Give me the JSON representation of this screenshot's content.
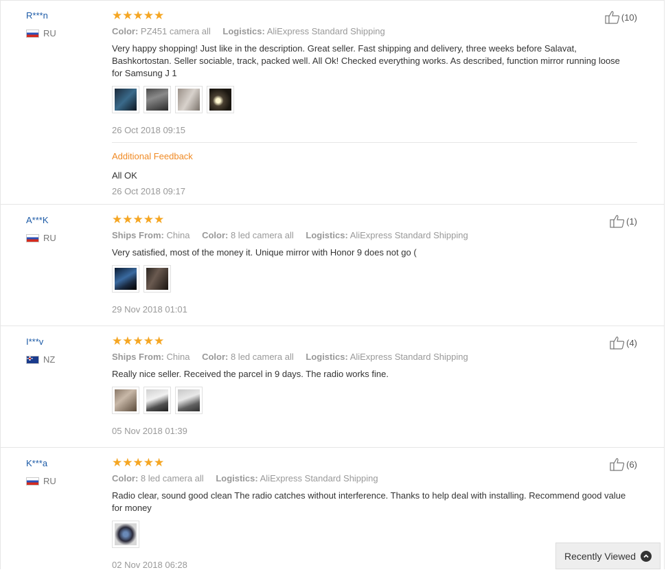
{
  "reviews": [
    {
      "user": "R***n",
      "country": "RU",
      "stars": "★★★★★",
      "meta": [
        {
          "key": "Color:",
          "value": "PZ451 camera all"
        },
        {
          "key": "Logistics:",
          "value": "AliExpress Standard Shipping"
        }
      ],
      "text": "Very happy shopping! Just like in the description. Great seller. Fast shipping and delivery, three weeks before Salavat, Bashkortostan. Seller sociable, track, packed well. All Ok! Checked everything works. As described, function mirror running loose for Samsung J 1",
      "date": "26 Oct 2018 09:15",
      "likes": "(10)",
      "additional": {
        "title": "Additional Feedback",
        "text": "All OK",
        "date": "26 Oct 2018 09:17"
      }
    },
    {
      "user": "A***K",
      "country": "RU",
      "stars": "★★★★★",
      "meta": [
        {
          "key": "Ships From:",
          "value": "China"
        },
        {
          "key": "Color:",
          "value": "8 led camera all"
        },
        {
          "key": "Logistics:",
          "value": "AliExpress Standard Shipping"
        }
      ],
      "text": "Very satisfied, most of the money it. Unique mirror with Honor 9 does not go (",
      "date": "29 Nov 2018 01:01",
      "likes": "(1)"
    },
    {
      "user": "I***v",
      "country": "NZ",
      "stars": "★★★★★",
      "meta": [
        {
          "key": "Ships From:",
          "value": "China"
        },
        {
          "key": "Color:",
          "value": "8 led camera all"
        },
        {
          "key": "Logistics:",
          "value": "AliExpress Standard Shipping"
        }
      ],
      "text": "Really nice seller. Received the parcel in 9 days. The radio works fine.",
      "date": "05 Nov 2018 01:39",
      "likes": "(4)"
    },
    {
      "user": "K***a",
      "country": "RU",
      "stars": "★★★★★",
      "meta": [
        {
          "key": "Color:",
          "value": "8 led camera all"
        },
        {
          "key": "Logistics:",
          "value": "AliExpress Standard Shipping"
        }
      ],
      "text": "Radio clear, sound good clean The radio catches without interference. Thanks to help deal with installing. Recommend good value for money",
      "date": "02 Nov 2018 06:28",
      "likes": "(6)"
    }
  ],
  "recently_viewed": {
    "label": "Recently Viewed",
    "icon": "chevron-up-icon"
  },
  "colors": {
    "username": "#1d5ba7",
    "star": "#f5a623",
    "additional_title": "#f08a24"
  }
}
